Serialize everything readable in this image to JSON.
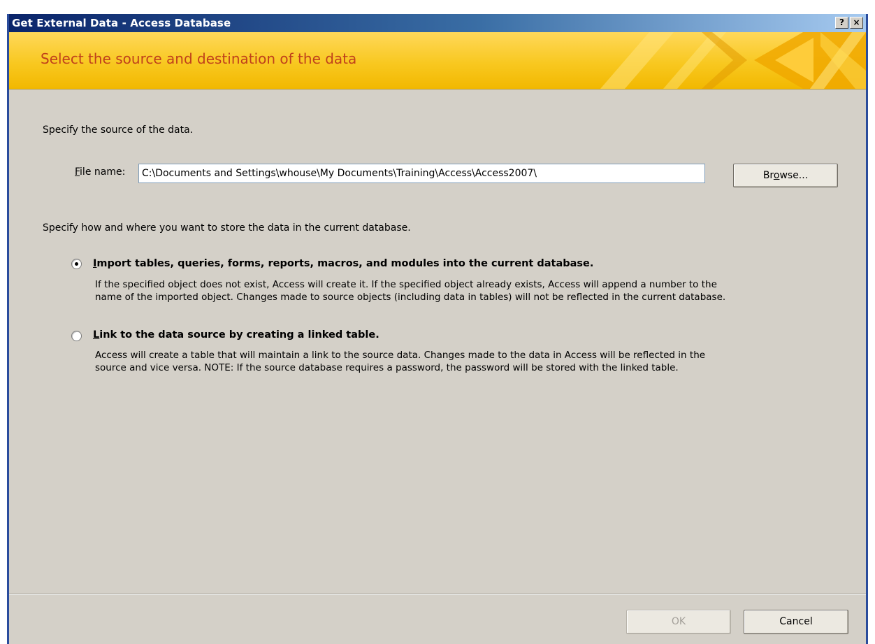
{
  "window": {
    "title": "Get External Data - Access Database",
    "help_button": "?",
    "close_button": "×"
  },
  "banner": {
    "heading": "Select the source and destination of the data"
  },
  "source": {
    "instruction": "Specify the source of the data.",
    "file_label_accel": "F",
    "file_label_rest": "ile name:",
    "file_value": "C:\\Documents and Settings\\whouse\\My Documents\\Training\\Access\\Access2007\\",
    "browse_pre": "Br",
    "browse_accel": "o",
    "browse_post": "wse..."
  },
  "storage": {
    "instruction": "Specify how and where you want to store the data in the current database.",
    "options": [
      {
        "accel": "I",
        "title_rest": "mport tables, queries, forms, reports, macros, and modules into the current database.",
        "line1": "If the specified object does not exist, Access will create it. If the specified object already exists, Access will append a number to the",
        "line2": "name of the imported object. Changes made to source objects (including data in tables) will not be reflected in the current database.",
        "selected": true
      },
      {
        "accel": "L",
        "title_rest": "ink to the data source by creating a linked table.",
        "line1": "Access will create a table that will maintain a link to the source data. Changes made to the data in Access will be reflected in the",
        "line2": "source and vice versa. NOTE:  If the source database requires a password, the password will be stored with the linked table.",
        "selected": false
      }
    ]
  },
  "footer": {
    "ok_label": "OK",
    "ok_enabled": false,
    "cancel_label": "Cancel"
  },
  "colors": {
    "title_bar": "#0a246a",
    "banner": "#f8c820",
    "heading_text": "#c0401b",
    "dialog_face": "#d4d0c8"
  }
}
